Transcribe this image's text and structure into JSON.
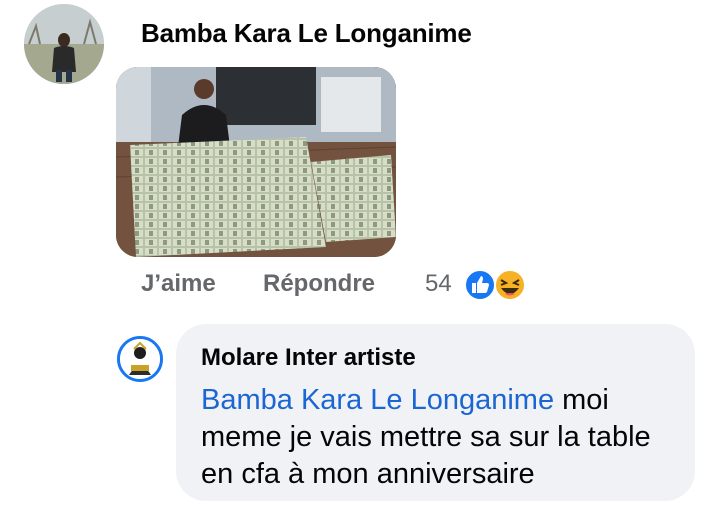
{
  "comment": {
    "author": "Bamba Kara Le Longanime",
    "actions": {
      "like": "J’aime",
      "reply": "Répondre"
    },
    "reaction_count": "54",
    "reactions": [
      "like-icon",
      "haha-icon"
    ],
    "colors": {
      "like_blue": "#1877f2",
      "haha_yellow": "#f7b125",
      "action_gray": "#65676b"
    }
  },
  "reply": {
    "author": "Molare Inter artiste",
    "mention": "Bamba Kara Le Longanime",
    "text": " moi meme je vais mettre sa sur la table en cfa à mon anniversaire",
    "colors": {
      "mention_blue": "#1b66d2",
      "bubble_bg": "#f0f2f5"
    }
  }
}
